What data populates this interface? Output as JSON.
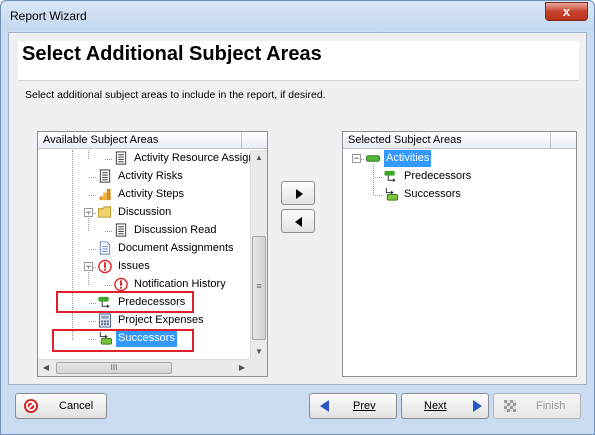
{
  "window": {
    "title": "Report Wizard",
    "close_glyph": "x"
  },
  "header": {
    "title": "Select Additional Subject Areas",
    "instructions": "Select additional subject areas to include in the report, if desired."
  },
  "available": {
    "column_header": "Available Subject Areas",
    "items": [
      {
        "label": "Activity Resource Assignm",
        "icon": "document-icon",
        "indent": 2,
        "selected": false
      },
      {
        "label": "Activity Risks",
        "icon": "document-icon",
        "indent": 1,
        "selected": false
      },
      {
        "label": "Activity Steps",
        "icon": "steps-icon",
        "indent": 1,
        "selected": false
      },
      {
        "label": "Discussion",
        "icon": "folder-icon",
        "indent": 1,
        "expanded": true,
        "selected": false
      },
      {
        "label": "Discussion Read",
        "icon": "document-icon",
        "indent": 2,
        "selected": false
      },
      {
        "label": "Document Assignments",
        "icon": "page-icon",
        "indent": 1,
        "selected": false
      },
      {
        "label": "Issues",
        "icon": "issue-icon",
        "indent": 1,
        "expanded": true,
        "selected": false
      },
      {
        "label": "Notification History",
        "icon": "issue-icon",
        "indent": 2,
        "selected": false
      },
      {
        "label": "Predecessors",
        "icon": "predecessor-icon",
        "indent": 1,
        "selected": false,
        "highlighted": true
      },
      {
        "label": "Project Expenses",
        "icon": "calculator-icon",
        "indent": 1,
        "selected": false
      },
      {
        "label": "Successors",
        "icon": "successor-icon",
        "indent": 1,
        "selected": true,
        "highlighted": true
      }
    ],
    "hscroll_glyph": "III",
    "vscroll_glyph": "≡"
  },
  "selected": {
    "column_header": "Selected Subject Areas",
    "items": [
      {
        "label": "Activities",
        "icon": "activity-bar-icon",
        "indent": 0,
        "expanded": true,
        "selected": true
      },
      {
        "label": "Predecessors",
        "icon": "predecessor-icon",
        "indent": 1,
        "selected": false
      },
      {
        "label": "Successors",
        "icon": "successor-icon",
        "indent": 1,
        "selected": false
      }
    ]
  },
  "buttons": {
    "add_glyph": "▶",
    "remove_glyph": "◀",
    "cancel": "Cancel",
    "prev": "Prev",
    "next": "Next",
    "finish": "Finish"
  },
  "colors": {
    "selection": "#3399ff",
    "highlight_box": "#e0202a",
    "window_frame": "#c9dcf2"
  }
}
